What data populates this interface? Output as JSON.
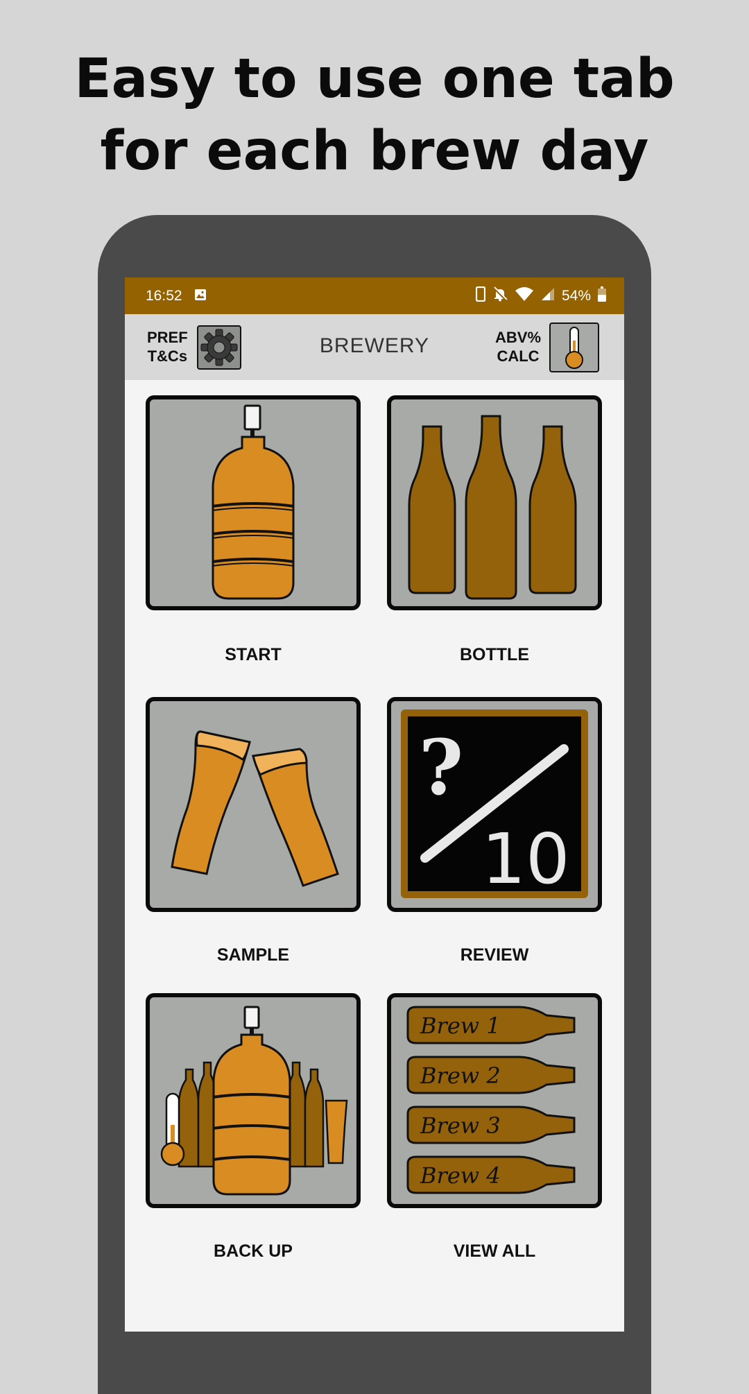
{
  "headline": {
    "line1": "Easy to use one tab",
    "line2": "for each brew day"
  },
  "status_bar": {
    "time": "16:52",
    "battery": "54%"
  },
  "toolbar": {
    "pref_line1": "PREF",
    "pref_line2": "T&Cs",
    "title": "BREWERY",
    "abv_line1": "ABV%",
    "abv_line2": "CALC"
  },
  "tiles": {
    "start": "START",
    "bottle": "BOTTLE",
    "sample": "SAMPLE",
    "review": "REVIEW",
    "backup": "BACK UP",
    "view_all": "VIEW ALL"
  },
  "review_board": {
    "question": "?",
    "score": "10"
  },
  "brew_labels": [
    "Brew 1",
    "Brew 2",
    "Brew 3",
    "Brew 4"
  ],
  "colors": {
    "accent": "#946200",
    "amber": "#d98c22",
    "bottle_brown": "#93620a",
    "tile_gray": "#a8aaa7"
  },
  "icons": [
    "gear-icon",
    "thermometer-icon",
    "carboy-icon",
    "bottles-icon",
    "glasses-icon",
    "chalkboard-icon",
    "brew-kit-icon",
    "brew-list-icon"
  ]
}
